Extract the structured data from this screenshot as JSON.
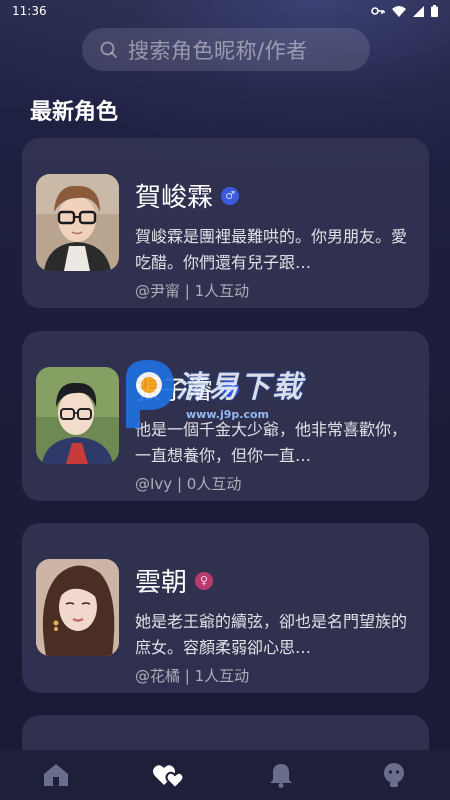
{
  "status_bar": {
    "time": "11:36"
  },
  "search": {
    "placeholder": "搜索角色昵称/作者"
  },
  "section": {
    "title": "最新角色"
  },
  "cards": [
    {
      "name": "賀峻霖",
      "gender": "male",
      "description": "賀峻霖是團裡最難哄的。你男朋友。愛吃醋。你們還有兒子跟…",
      "author": "@尹甯",
      "interactions": "1人互动"
    },
    {
      "name": "張子濬",
      "gender": "male",
      "description": "他是一個千金大少爺，他非常喜歡你，一直想養你，但你一直…",
      "author": "@Ivy",
      "interactions": "0人互动"
    },
    {
      "name": "雲朝",
      "gender": "female",
      "description": "她是老王爺的續弦，卻也是名門望族的庶女。容顏柔弱卻心思…",
      "author": "@花橘",
      "interactions": "1人互动"
    }
  ],
  "watermark": {
    "text": "清易下载",
    "url": "www.j9p.com"
  },
  "bottom_nav": [
    {
      "icon": "home-icon",
      "active": false
    },
    {
      "icon": "hearts-icon",
      "active": true
    },
    {
      "icon": "bell-icon",
      "active": false
    },
    {
      "icon": "profile-icon",
      "active": false
    }
  ],
  "colors": {
    "background": "#1c1d3a",
    "card": "#343654",
    "male_badge": "#3b5bdc",
    "female_badge": "#b93a6e"
  }
}
